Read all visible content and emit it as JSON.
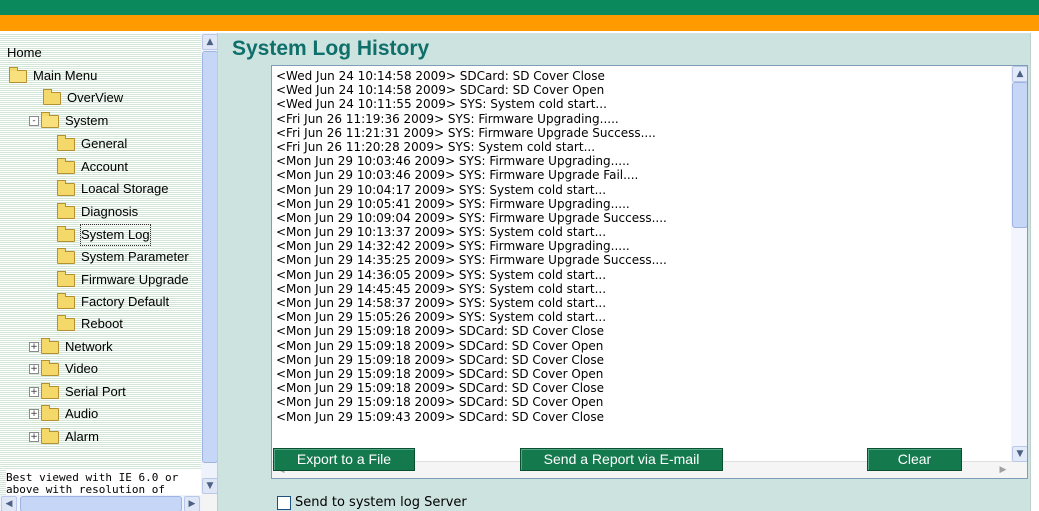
{
  "page": {
    "title": "System Log History"
  },
  "sidebar": {
    "home": "Home",
    "main_menu": "Main Menu",
    "items": [
      {
        "label": "OverView"
      },
      {
        "label": "System",
        "expander": "-"
      },
      {
        "label": "General"
      },
      {
        "label": "Account"
      },
      {
        "label": "Loacal Storage"
      },
      {
        "label": "Diagnosis"
      },
      {
        "label": "System Log"
      },
      {
        "label": "System Parameter"
      },
      {
        "label": "Firmware Upgrade"
      },
      {
        "label": "Factory Default"
      },
      {
        "label": "Reboot"
      },
      {
        "label": "Network",
        "expander": "+"
      },
      {
        "label": "Video",
        "expander": "+"
      },
      {
        "label": "Serial Port",
        "expander": "+"
      },
      {
        "label": "Audio",
        "expander": "+"
      },
      {
        "label": "Alarm",
        "expander": "+"
      }
    ],
    "note": "Best viewed with IE 6.0 or above with resolution of"
  },
  "log": {
    "lines": [
      "<Wed Jun 24 10:14:58 2009> SDCard: SD Cover Close",
      "<Wed Jun 24 10:14:58 2009> SDCard: SD Cover Open",
      "<Wed Jun 24 10:11:55 2009> SYS: System cold start...",
      "<Fri Jun 26 11:19:36 2009> SYS: Firmware Upgrading.....",
      "<Fri Jun 26 11:21:31 2009> SYS: Firmware Upgrade Success....",
      "<Fri Jun 26 11:20:28 2009> SYS: System cold start...",
      "<Mon Jun 29 10:03:46 2009> SYS: Firmware Upgrading.....",
      "<Mon Jun 29 10:03:46 2009> SYS: Firmware Upgrade Fail....",
      "<Mon Jun 29 10:04:17 2009> SYS: System cold start...",
      "<Mon Jun 29 10:05:41 2009> SYS: Firmware Upgrading.....",
      "<Mon Jun 29 10:09:04 2009> SYS: Firmware Upgrade Success....",
      "<Mon Jun 29 10:13:37 2009> SYS: System cold start...",
      "<Mon Jun 29 14:32:42 2009> SYS: Firmware Upgrading.....",
      "<Mon Jun 29 14:35:25 2009> SYS: Firmware Upgrade Success....",
      "<Mon Jun 29 14:36:05 2009> SYS: System cold start...",
      "<Mon Jun 29 14:45:45 2009> SYS: System cold start...",
      "<Mon Jun 29 14:58:37 2009> SYS: System cold start...",
      "<Mon Jun 29 15:05:26 2009> SYS: System cold start...",
      "<Mon Jun 29 15:09:18 2009> SDCard: SD Cover Close",
      "<Mon Jun 29 15:09:18 2009> SDCard: SD Cover Open",
      "<Mon Jun 29 15:09:18 2009> SDCard: SD Cover Close",
      "<Mon Jun 29 15:09:18 2009> SDCard: SD Cover Open",
      "<Mon Jun 29 15:09:18 2009> SDCard: SD Cover Close",
      "<Mon Jun 29 15:09:18 2009> SDCard: SD Cover Open",
      "<Mon Jun 29 15:09:43 2009> SDCard: SD Cover Close"
    ]
  },
  "buttons": {
    "export": "Export to a File",
    "email": "Send a Report via E-mail",
    "clear": "Clear"
  },
  "send_server": {
    "label": "Send to system log Server",
    "checked": false
  },
  "colors": {
    "top_bar": "#0a8a5c",
    "accent_bar": "#ff9a00",
    "title": "#0f6f6a",
    "button": "#147a4e",
    "content_bg": "#cde3df"
  }
}
